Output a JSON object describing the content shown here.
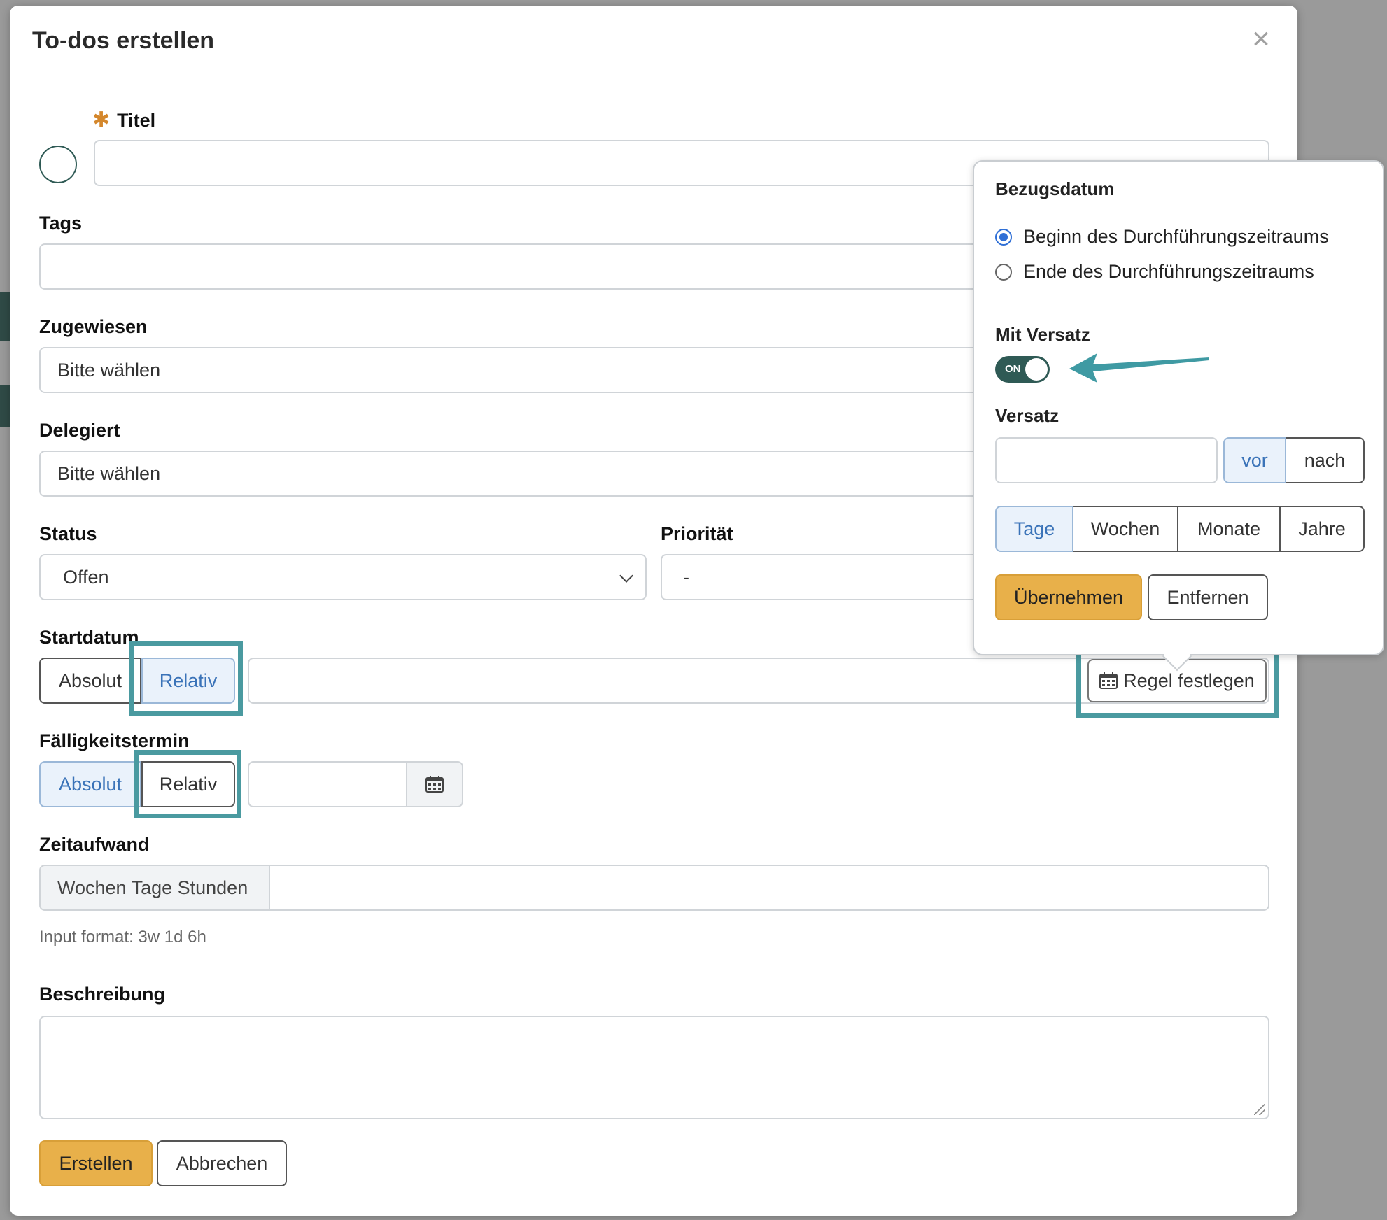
{
  "modal": {
    "title": "To-dos erstellen",
    "close_symbol": "×"
  },
  "form": {
    "title_label": "Titel",
    "title_value": "",
    "tags_label": "Tags",
    "assigned_label": "Zugewiesen",
    "assigned_value": "Bitte wählen",
    "delegated_label": "Delegiert",
    "delegated_value": "Bitte wählen",
    "status_label": "Status",
    "status_value": "Offen",
    "priority_label": "Priorität",
    "priority_value": "-",
    "start_label": "Startdatum",
    "start_absolute": "Absolut",
    "start_relative": "Relativ",
    "rule_button": "Regel festlegen",
    "due_label": "Fälligkeitstermin",
    "due_absolute": "Absolut",
    "due_relative": "Relativ",
    "effort_label": "Zeitaufwand",
    "effort_addon": "Wochen Tage Stunden",
    "effort_hint": "Input format: 3w 1d 6h",
    "description_label": "Beschreibung",
    "create_button": "Erstellen",
    "cancel_button": "Abbrechen"
  },
  "popover": {
    "reference_label": "Bezugsdatum",
    "option_start": "Beginn des Durchführungszeitraums",
    "option_end": "Ende des Durchführungszeitraums",
    "selected_option": "start",
    "offset_toggle_label": "Mit Versatz",
    "toggle_state": "ON",
    "offset_label": "Versatz",
    "offset_value": "",
    "before": "vor",
    "after": "nach",
    "units": [
      "Tage",
      "Wochen",
      "Monate",
      "Jahre"
    ],
    "active_unit": "Tage",
    "apply_button": "Übernehmen",
    "remove_button": "Entfernen"
  },
  "colors": {
    "accent_teal": "#4a9aa0",
    "primary_button": "#e8b04a",
    "active_blue": "#3a73b8",
    "toggle_on": "#2f5a55"
  },
  "icons": {
    "close": "close-icon",
    "calendar": "calendar-icon",
    "chevron": "chevron-down-icon",
    "arrow": "arrow-annotation-icon"
  }
}
